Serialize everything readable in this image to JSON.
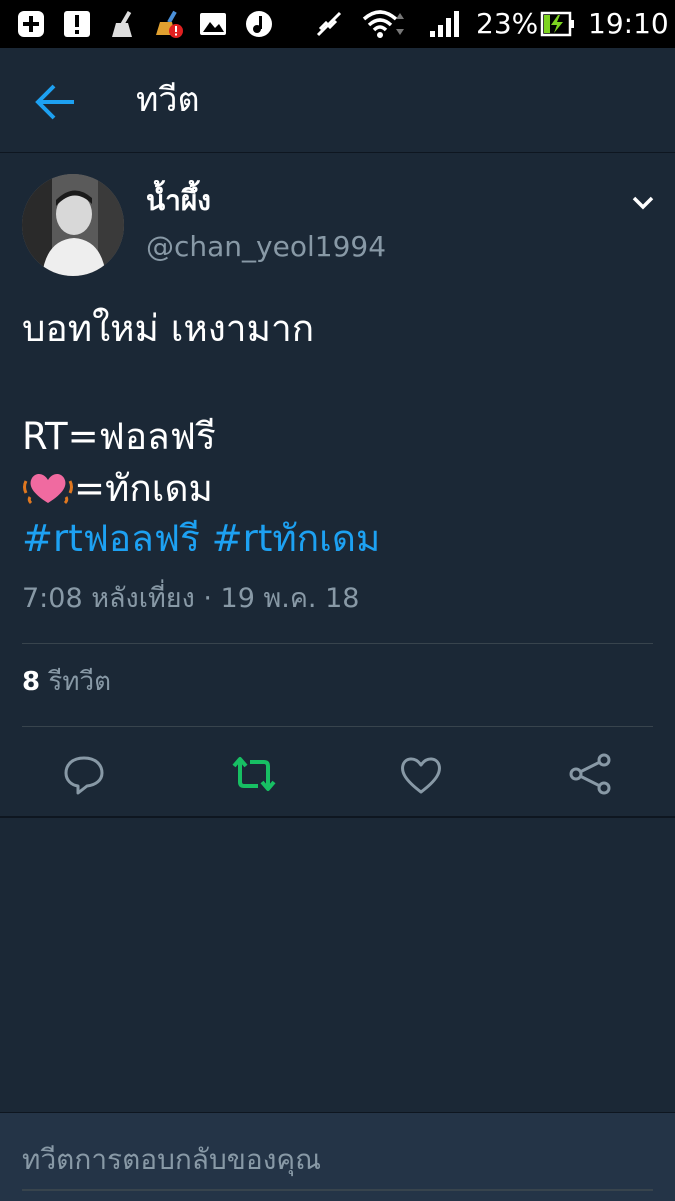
{
  "status_bar": {
    "battery_percent": "23%",
    "time": "19:10"
  },
  "header": {
    "title": "ทวีต"
  },
  "tweet": {
    "display_name": "น้ำผึ้ง",
    "handle": "@chan_yeol1994",
    "line1": "บอทใหม่  เหงามาก",
    "line2": "RT=ฟอลฟรี",
    "line3_suffix": "=ทักเดม",
    "hashtag1": "#rtฟอลฟรี",
    "hashtag2": "#rtทักเดม",
    "timestamp": "7:08 หลังเที่ยง · 19 พ.ค. 18",
    "retweet_count": "8",
    "retweet_label": "รีทวีต"
  },
  "composer": {
    "placeholder": "ทวีตการตอบกลับของคุณ"
  },
  "colors": {
    "background": "#1b2836",
    "accent": "#1da1f2",
    "retweet_active": "#17bf63",
    "secondary_text": "#8899a6"
  }
}
